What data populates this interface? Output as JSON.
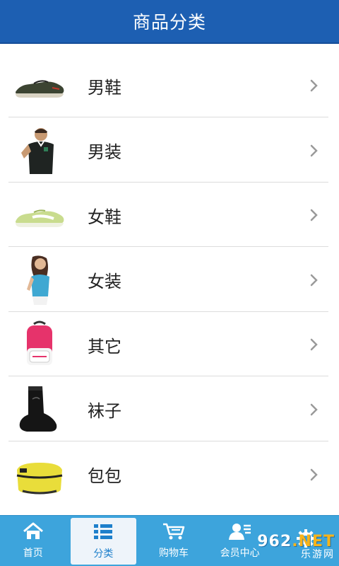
{
  "header": {
    "title": "商品分类"
  },
  "categories": [
    {
      "label": "男鞋",
      "icon": "mens-shoe-image"
    },
    {
      "label": "男装",
      "icon": "mens-clothing-image"
    },
    {
      "label": "女鞋",
      "icon": "womens-shoe-image"
    },
    {
      "label": "女装",
      "icon": "womens-clothing-image"
    },
    {
      "label": "其它",
      "icon": "backpack-image"
    },
    {
      "label": "袜子",
      "icon": "sock-image"
    },
    {
      "label": "包包",
      "icon": "bag-image"
    }
  ],
  "tabbar": {
    "items": [
      {
        "label": "首页",
        "icon": "home-icon",
        "active": false
      },
      {
        "label": "分类",
        "icon": "category-list-icon",
        "active": true
      },
      {
        "label": "购物车",
        "icon": "cart-icon",
        "active": false
      },
      {
        "label": "会员中心",
        "icon": "member-icon",
        "active": false
      },
      {
        "label": "",
        "icon": "gear-icon",
        "active": false
      }
    ]
  },
  "watermark": {
    "top": "962",
    "top_accent": ".NET",
    "bottom": "乐游网"
  },
  "colors": {
    "header_bg": "#1d5fb2",
    "tabbar_bg": "#3da4dc",
    "active_tab_bg": "#eef4fa",
    "chevron": "#9a9a9a"
  }
}
